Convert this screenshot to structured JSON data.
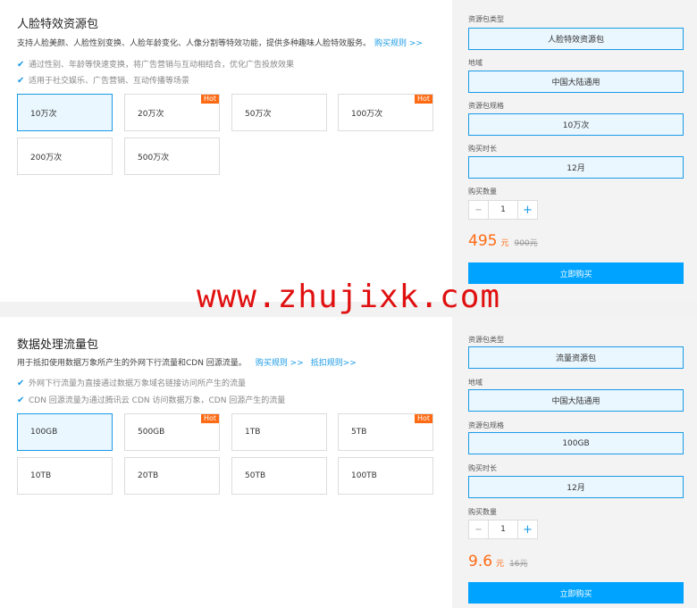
{
  "section1": {
    "title": "人脸特效资源包",
    "desc": "支持人脸美颜、人脸性别变换、人脸年龄变化、人像分割等特效功能，提供多种趣味人脸特效服务。",
    "link": "购买规则 >>",
    "bullets": [
      "通过性别、年龄等快速变换，将广告营销与互动相结合，优化广告投放效果",
      "适用于社交娱乐、广告营销、互动传播等场景"
    ],
    "options": [
      "10万次",
      "20万次",
      "50万次",
      "100万次",
      "200万次",
      "500万次"
    ],
    "hot_label": "Hot",
    "labels": {
      "type": "资源包类型",
      "region": "地域",
      "spec": "资源包规格",
      "duration": "购买时长",
      "qty": "购买数量"
    },
    "values": {
      "type": "人脸特效资源包",
      "region": "中国大陆通用",
      "spec": "10万次",
      "duration": "12月",
      "qty": "1"
    },
    "price": "495",
    "unit": "元",
    "old_price": "900元",
    "buy": "立即购买"
  },
  "section2": {
    "title": "数据处理流量包",
    "desc": "用于抵扣使用数据万象所产生的外网下行流量和CDN 回源流量。",
    "link1": "购买规则 >>",
    "link2": "抵扣规则>>",
    "bullets": [
      "外网下行流量为直接通过数据万象域名链接访问所产生的流量",
      "CDN 回源流量为通过腾讯云 CDN 访问数据万象，CDN 回源产生的流量"
    ],
    "options": [
      "100GB",
      "500GB",
      "1TB",
      "5TB",
      "10TB",
      "20TB",
      "50TB",
      "100TB"
    ],
    "hot_label": "Hot",
    "labels": {
      "type": "资源包类型",
      "region": "地域",
      "spec": "资源包规格",
      "duration": "购买时长",
      "qty": "购买数量"
    },
    "values": {
      "type": "流量资源包",
      "region": "中国大陆通用",
      "spec": "100GB",
      "duration": "12月",
      "qty": "1"
    },
    "price": "9.6",
    "unit": "元",
    "old_price": "16元",
    "buy": "立即购买"
  },
  "stepper": {
    "minus": "−",
    "plus": "+"
  },
  "check_icon": "✔",
  "watermark": "www.zhujixk.com",
  "colors": {
    "accent": "#1a9ae6",
    "price": "#ff6a13",
    "buy": "#00a3ff",
    "hot": "#ff6a13",
    "watermark": "#e01010"
  }
}
